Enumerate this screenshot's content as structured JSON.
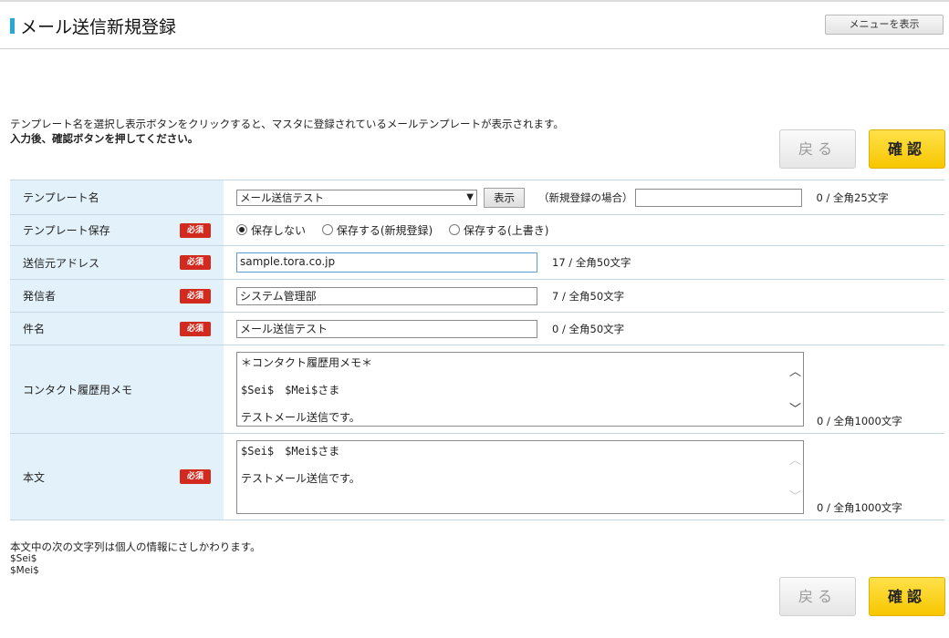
{
  "header": {
    "title": "メール送信新規登録",
    "menu_button": "メニューを表示"
  },
  "intro": {
    "line1": "テンプレート名を選択し表示ボタンをクリックすると、マスタに登録されているメールテンプレートが表示されます。",
    "line2": "入力後、確認ボタンを押してください。"
  },
  "buttons": {
    "back": "戻る",
    "confirm": "確認"
  },
  "required_badge": "必須",
  "form": {
    "template_name": {
      "label": "テンプレート名",
      "selected": "メール送信テスト",
      "show_button": "表示",
      "new_label": "（新規登録の場合）",
      "new_value": "",
      "counter": "0 / 全角25文字"
    },
    "template_save": {
      "label": "テンプレート保存",
      "options": [
        "保存しない",
        "保存する(新規登録)",
        "保存する(上書き)"
      ]
    },
    "sender_address": {
      "label": "送信元アドレス",
      "value": "sample.tora.co.jp",
      "counter": "17 / 全角50文字"
    },
    "sender": {
      "label": "発信者",
      "value": "システム管理部",
      "counter": "7 / 全角50文字"
    },
    "subject": {
      "label": "件名",
      "value": "メール送信テスト",
      "counter": "0 / 全角50文字"
    },
    "memo": {
      "label": "コンタクト履歴用メモ",
      "lines": [
        "＊コンタクト履歴用メモ＊",
        "",
        "$Sei$　$Mei$さま",
        "",
        "テストメール送信です。"
      ],
      "counter": "0 / 全角1000文字"
    },
    "body": {
      "label": "本文",
      "lines": [
        "$Sei$　$Mei$さま",
        "",
        "テストメール送信です。"
      ],
      "counter": "0 / 全角1000文字"
    }
  },
  "note": {
    "text": "本文中の次の文字列は個人の情報にさしかわります。",
    "vars": [
      "$Sei$",
      "$Mei$"
    ]
  }
}
